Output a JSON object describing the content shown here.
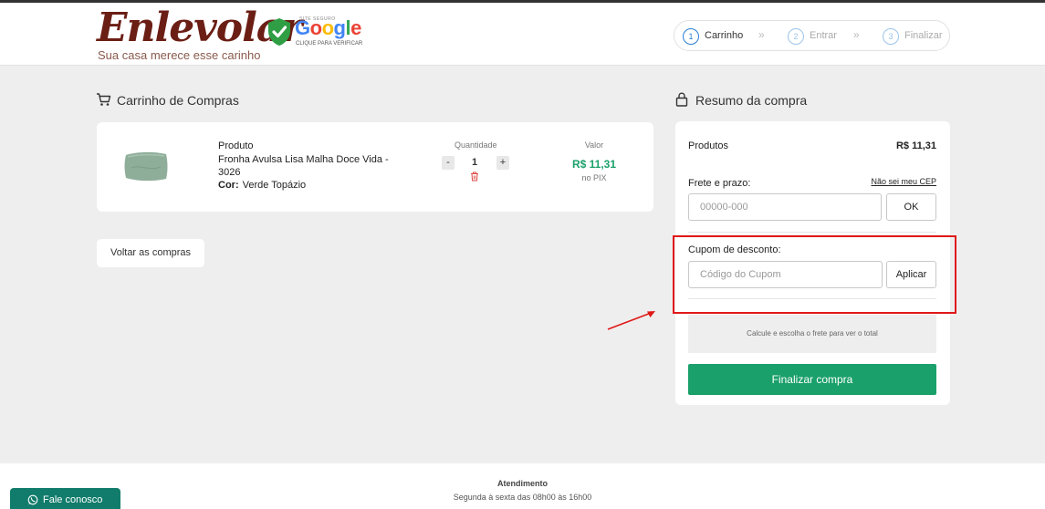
{
  "header": {
    "logo_text": "Enlevolar",
    "logo_tagline": "Sua casa merece esse carinho",
    "seal": {
      "top_text": "SITE SEGURO",
      "brand": "Google",
      "click_text": "CLIQUE PARA VERIFICAR"
    },
    "steps": [
      {
        "number": "1",
        "label": "Carrinho",
        "active": true
      },
      {
        "number": "2",
        "label": "Entrar",
        "active": false
      },
      {
        "number": "3",
        "label": "Finalizar",
        "active": false
      }
    ],
    "step_separator": "»"
  },
  "cart": {
    "title": "Carrinho de Compras",
    "product_label": "Produto",
    "product_name": "Fronha Avulsa Lisa Malha Doce Vida - 3026",
    "color_label": "Cor:",
    "color_value": "Verde Topázio",
    "quantity_label": "Quantidade",
    "quantity_minus": "-",
    "quantity_value": "1",
    "quantity_plus": "+",
    "value_label": "Valor",
    "price": "R$ 11,31",
    "price_note": "no PIX",
    "continue_button": "Voltar as compras"
  },
  "summary": {
    "title": "Resumo da compra",
    "products_label": "Produtos",
    "products_value": "R$ 11,31",
    "shipping_label": "Frete e prazo:",
    "cep_link": "Não sei meu CEP",
    "cep_placeholder": "00000-000",
    "ok_button": "OK",
    "coupon_label": "Cupom de desconto:",
    "coupon_placeholder": "Código do Cupom",
    "apply_button": "Aplicar",
    "shipping_note": "Calcule e escolha o frete para ver o total",
    "checkout_button": "Finalizar compra"
  },
  "footer": {
    "title": "Atendimento",
    "hours": "Segunda à sexta das 08h00 às 16h00",
    "whatsapp_button": "Fale conosco"
  },
  "colors": {
    "brand": "#6b1e14",
    "accent_green": "#1aa06a",
    "step_active": "#2a7fd4",
    "highlight_red": "#e01818",
    "whatsapp_green": "#117c6b"
  }
}
